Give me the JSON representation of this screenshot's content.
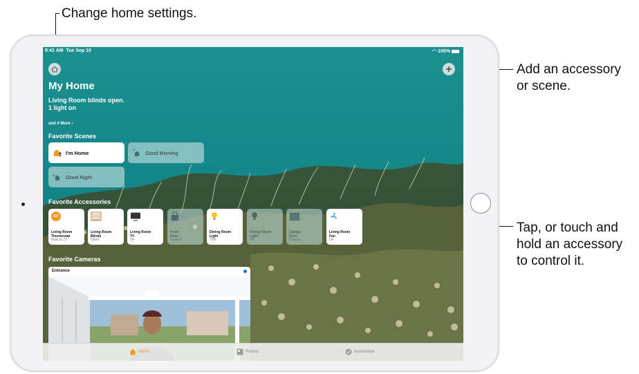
{
  "callouts": {
    "settings": "Change home settings.",
    "add_line1": "Add an accessory",
    "add_line2": "or scene.",
    "tap_line1": "Tap, or touch and",
    "tap_line2": "hold an accessory",
    "tap_line3": "to control it."
  },
  "status_bar": {
    "time": "9:41 AM",
    "date": "Tue Sep 10",
    "battery": "100%"
  },
  "home": {
    "title": "My Home",
    "status_line1": "Living Room blinds open.",
    "status_line2": "1 light on",
    "more_link": "and 4 More ›"
  },
  "favorite_scenes": {
    "heading": "Favorite Scenes",
    "items": [
      {
        "label": "I'm Home",
        "active": true
      },
      {
        "label": "Good Morning",
        "active": false
      },
      {
        "label": "Good Night",
        "active": false
      }
    ]
  },
  "favorite_accessories": {
    "heading": "Favorite Accessories",
    "items": [
      {
        "badge": "68°",
        "line1": "Living Room",
        "line2": "Thermostat",
        "status": "Heat to 72°",
        "active": true,
        "icon": "thermostat-icon"
      },
      {
        "line1": "Living Room",
        "line2": "Blinds",
        "status": "Open",
        "active": true,
        "icon": "blinds-icon"
      },
      {
        "line1": "Living Room",
        "line2": "TV",
        "status": "On",
        "active": true,
        "icon": "tv-icon"
      },
      {
        "line1": "Front",
        "line2": "Door",
        "status": "Locked",
        "active": false,
        "icon": "lock-icon"
      },
      {
        "line1": "Dining Room",
        "line2": "Light",
        "status": "70%",
        "active": true,
        "icon": "lightbulb-icon"
      },
      {
        "line1": "Dining Room",
        "line2": "Light",
        "status": "Off",
        "active": false,
        "icon": "lightbulb-icon"
      },
      {
        "line1": "Garage",
        "line2": "Door",
        "status": "Closed",
        "active": false,
        "icon": "garage-door-icon"
      },
      {
        "line1": "Living Room",
        "line2": "Fan",
        "status": "On",
        "active": true,
        "icon": "fan-icon"
      }
    ]
  },
  "favorite_cameras": {
    "heading": "Favorite Cameras",
    "camera_label": "Entrance"
  },
  "tabs": [
    {
      "label": "Home",
      "active": true
    },
    {
      "label": "Rooms",
      "active": false
    },
    {
      "label": "Automation",
      "active": false
    }
  ],
  "colors": {
    "accent": "#f29a22",
    "wallpaper": "#15878a",
    "camera_live": "#1f6fe0"
  }
}
